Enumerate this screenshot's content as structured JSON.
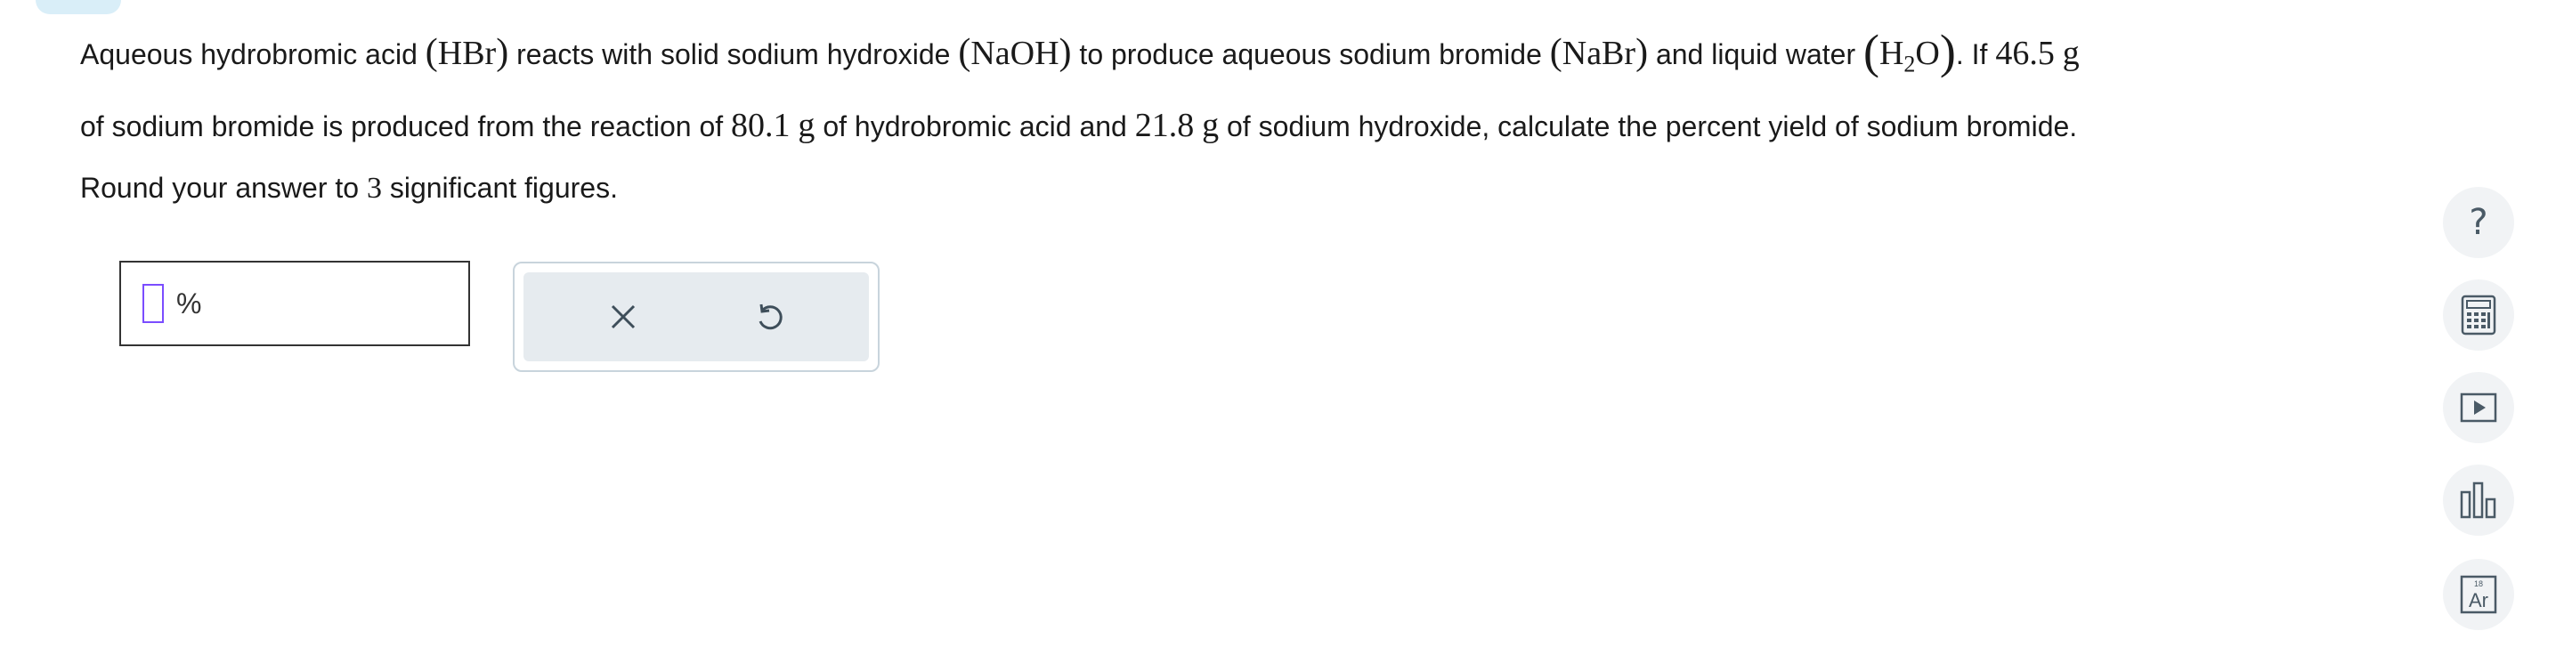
{
  "question": {
    "seg1": "Aqueous hydrobromic acid ",
    "hbr": "HBr",
    "seg2": " reacts with solid sodium hydroxide ",
    "naoh": "NaOH",
    "seg3": " to produce aqueous sodium bromide ",
    "nabr": "NaBr",
    "seg4": " and liquid water ",
    "h2o_h": "H",
    "h2o_sub": "2",
    "h2o_o": "O",
    "seg5": ". If ",
    "mass_nabr": "46.5",
    "unit_g": "g",
    "seg6": "of sodium bromide is produced from the reaction of ",
    "mass_hbr": "80.1",
    "seg7": " of hydrobromic acid and ",
    "mass_naoh": "21.8",
    "seg8": " of sodium hydroxide, calculate the percent yield of sodium bromide."
  },
  "instruction": {
    "before": "Round your answer to ",
    "digits": "3",
    "after": " significant figures."
  },
  "answer": {
    "value": "",
    "unit": "%"
  },
  "actions": {
    "clear_icon": "x-icon",
    "undo_icon": "undo-icon"
  },
  "tools": [
    {
      "icon": "help-icon",
      "glyph": "?"
    },
    {
      "icon": "calculator-icon"
    },
    {
      "icon": "video-icon"
    },
    {
      "icon": "data-chart-icon"
    },
    {
      "icon": "periodic-table-icon",
      "symbol": "Ar",
      "number": "18"
    }
  ],
  "colors": {
    "cursor": "#7b4dff",
    "tool_bg": "#f1f3f5",
    "action_bg": "#e6ebef",
    "tab": "#d9eef8"
  }
}
